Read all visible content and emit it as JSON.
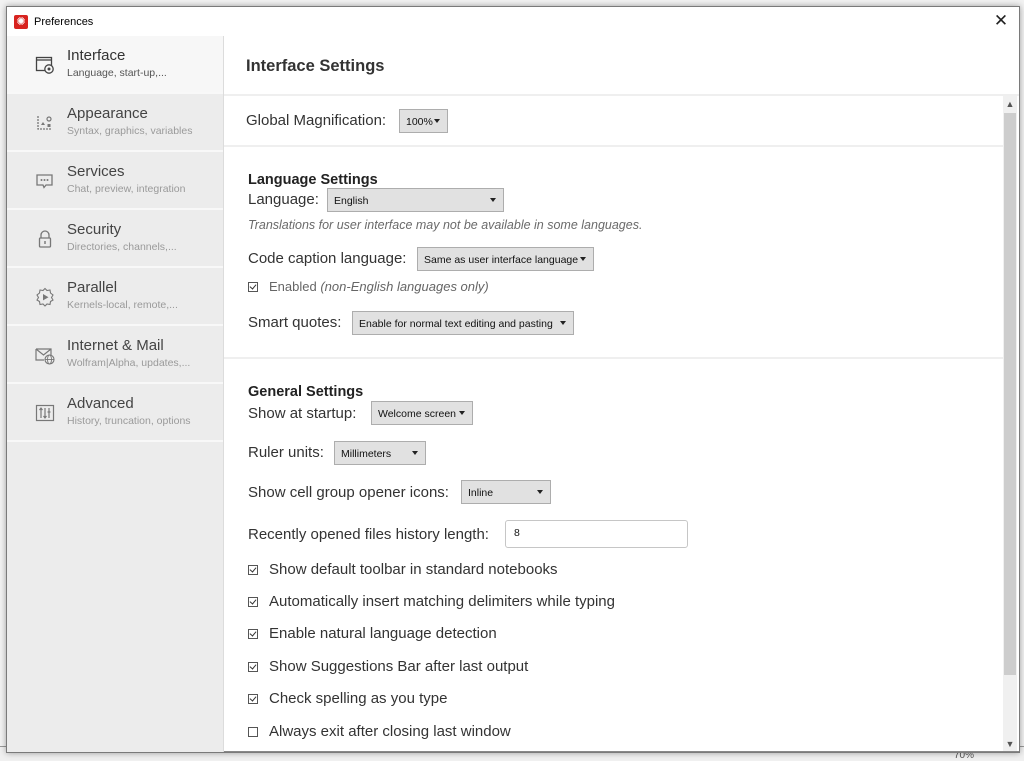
{
  "window": {
    "title": "Preferences",
    "close_label": "✕",
    "background_zoom": "70%"
  },
  "sidebar": {
    "items": [
      {
        "title": "Interface",
        "subtitle": "Language, start-up,...",
        "icon": "interface-window-gear-icon",
        "active": true
      },
      {
        "title": "Appearance",
        "subtitle": "Syntax, graphics, variables",
        "icon": "appearance-chart-icon",
        "active": false
      },
      {
        "title": "Services",
        "subtitle": "Chat, preview, integration",
        "icon": "services-chat-bubble-icon",
        "active": false
      },
      {
        "title": "Security",
        "subtitle": "Directories, channels,...",
        "icon": "security-lock-icon",
        "active": false
      },
      {
        "title": "Parallel",
        "subtitle": "Kernels-local, remote,...",
        "icon": "parallel-gear-play-icon",
        "active": false
      },
      {
        "title": "Internet & Mail",
        "subtitle": "Wolfram|Alpha, updates,...",
        "icon": "internet-mail-globe-icon",
        "active": false
      },
      {
        "title": "Advanced",
        "subtitle": "History, truncation, options",
        "icon": "advanced-sliders-icon",
        "active": false
      }
    ]
  },
  "main": {
    "title": "Interface Settings",
    "magnification": {
      "label": "Global Magnification:",
      "value": "100%"
    },
    "language_section": {
      "title": "Language Settings",
      "language": {
        "label": "Language:",
        "value": "English"
      },
      "note": "Translations for user interface may not be available in some languages.",
      "code_caption": {
        "label": "Code caption language:",
        "value": "Same as user interface language"
      },
      "enabled": {
        "label": "Enabled",
        "label_italic": "(non-English languages only)",
        "checked": true
      },
      "smart_quotes": {
        "label": "Smart quotes:",
        "value": "Enable for normal text editing and pasting"
      }
    },
    "general_section": {
      "title": "General Settings",
      "startup": {
        "label": "Show at startup:",
        "value": "Welcome screen"
      },
      "ruler_units": {
        "label": "Ruler units:",
        "value": "Millimeters"
      },
      "cell_group_opener": {
        "label": "Show cell group opener icons:",
        "value": "Inline"
      },
      "history_length": {
        "label": "Recently opened files history length:",
        "value": "8"
      },
      "checkboxes": [
        {
          "label": "Show default toolbar in standard notebooks",
          "checked": true
        },
        {
          "label": "Automatically insert matching delimiters while typing",
          "checked": true
        },
        {
          "label": "Enable natural language detection",
          "checked": true
        },
        {
          "label": "Show Suggestions Bar after last output",
          "checked": true
        },
        {
          "label": "Check spelling as you type",
          "checked": true
        },
        {
          "label": "Always exit after closing last window",
          "checked": false
        }
      ]
    }
  }
}
